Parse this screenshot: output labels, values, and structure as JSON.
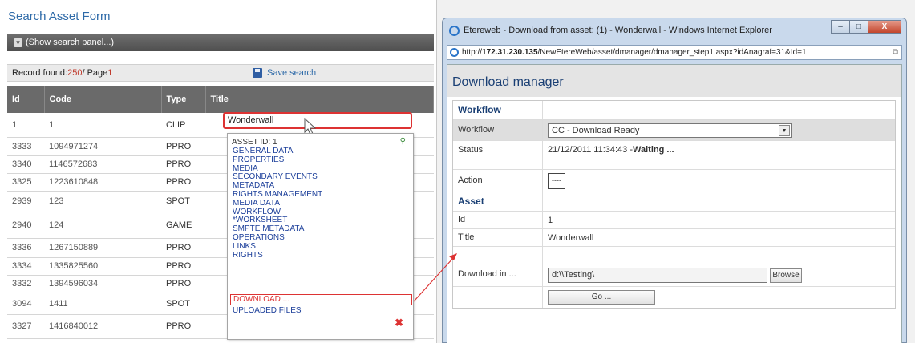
{
  "left_panel": {
    "title": "Search Asset Form",
    "search_toggle_label": "(Show search panel...)",
    "record_prefix": "Record found: ",
    "record_count": "250",
    "record_mid": " / Page ",
    "page_number": "1",
    "save_search_label": "Save search",
    "columns": [
      "Id",
      "Code",
      "Type",
      "Title"
    ],
    "rows": [
      {
        "id": "1",
        "code": "1",
        "type": "CLIP"
      },
      {
        "id": "3333",
        "code": "1094971274",
        "type": "PPRO"
      },
      {
        "id": "3340",
        "code": "1146572683",
        "type": "PPRO"
      },
      {
        "id": "3325",
        "code": "1223610848",
        "type": "PPRO"
      },
      {
        "id": "2939",
        "code": "123",
        "type": "SPOT"
      },
      {
        "id": "2940",
        "code": "124",
        "type": "GAME"
      },
      {
        "id": "3336",
        "code": "1267150889",
        "type": "PPRO"
      },
      {
        "id": "3334",
        "code": "1335825560",
        "type": "PPRO"
      },
      {
        "id": "3332",
        "code": "1394596034",
        "type": "PPRO"
      },
      {
        "id": "3094",
        "code": "1411",
        "type": "SPOT"
      },
      {
        "id": "3327",
        "code": "1416840012",
        "type": "PPRO"
      }
    ],
    "selected_title": "Wonderwall"
  },
  "context_menu": {
    "asset_id_label": "ASSET ID: 1",
    "items": [
      "GENERAL DATA",
      "PROPERTIES",
      "MEDIA",
      "SECONDARY EVENTS",
      "METADATA",
      "RIGHTS MANAGEMENT",
      "MEDIA DATA",
      "WORKFLOW",
      "*WORKSHEET",
      "SMPTE METADATA",
      "OPERATIONS",
      "LINKS",
      "RIGHTS"
    ],
    "download_label": "DOWNLOAD ...",
    "uploaded_label": "UPLOADED FILES",
    "icons": {
      "corner": "node-link-icon",
      "close": "close-x-icon"
    }
  },
  "ie_window": {
    "title": "Etereweb - Download from asset: (1) - Wonderwall - Windows Internet Explorer",
    "url_prefix": "http://",
    "url_host": "172.31.230.135",
    "url_path": "/NewEtereWeb/asset/dmanager/dmanager_step1.aspx?idAnagraf=31&Id=1",
    "minimize": "–",
    "maximize": "□",
    "close": "X"
  },
  "download_manager": {
    "header": "Download manager",
    "workflow_section": "Workflow",
    "workflow_label": "Workflow",
    "workflow_value": "CC - Download Ready",
    "status_label": "Status",
    "status_time": "21/12/2011 11:34:43 - ",
    "status_state": "Waiting ...",
    "action_label": "Action",
    "action_button": "----",
    "asset_section": "Asset",
    "id_label": "Id",
    "id_value": "1",
    "title_label": "Title",
    "title_value": "Wonderwall",
    "download_label": "Download in ...",
    "download_path": "d:\\\\Testing\\",
    "browse_label": "Browse",
    "go_label": "Go ..."
  },
  "colors": {
    "accent_red": "#d33333",
    "link_blue": "#1c3f9a",
    "header_blue": "#1a3f74"
  }
}
